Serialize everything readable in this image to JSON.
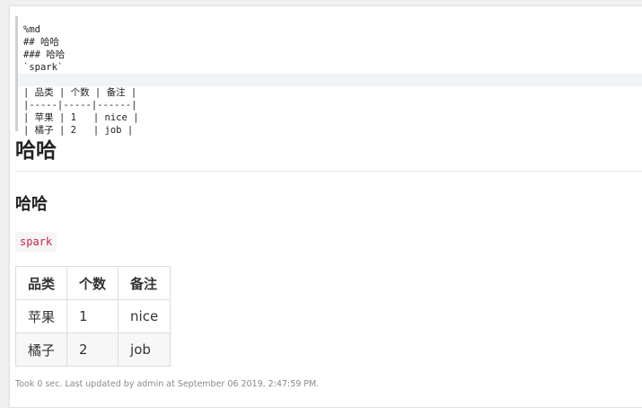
{
  "editor": {
    "lines": [
      "%md",
      "## 哈哈",
      "### 哈哈",
      "`spark`",
      "",
      "| 品类 | 个数 | 备注 |",
      "|-----|-----|------|",
      "| 苹果 | 1   | nice |",
      "| 橘子 | 2   | job |"
    ]
  },
  "output": {
    "h2": "哈哈",
    "h3": "哈哈",
    "code": "spark",
    "table": {
      "headers": [
        "品类",
        "个数",
        "备注"
      ],
      "rows": [
        [
          "苹果",
          "1",
          "nice"
        ],
        [
          "橘子",
          "2",
          "job"
        ]
      ]
    }
  },
  "footer": "Took 0 sec. Last updated by admin at September 06 2019, 2:47:59 PM."
}
